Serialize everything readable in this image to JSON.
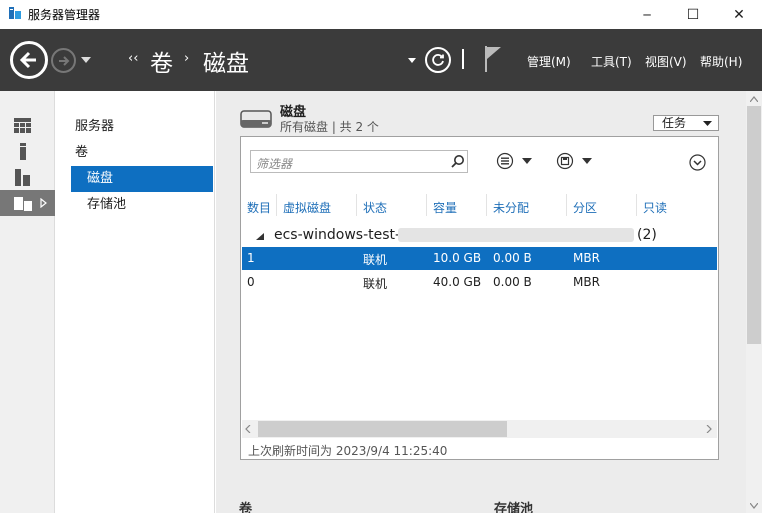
{
  "window": {
    "title": "服务器管理器",
    "controls": {
      "minimize": "─",
      "maximize": "☐",
      "close": "✕"
    }
  },
  "navbar": {
    "breadcrumb": {
      "sep1": "‹‹",
      "level1": "卷",
      "sep2": "›",
      "level2": "磁盘"
    },
    "menu": [
      "管理(M)",
      "工具(T)",
      "视图(V)",
      "帮助(H)"
    ]
  },
  "tree": {
    "items": [
      {
        "label": "服务器"
      },
      {
        "label": "卷"
      },
      {
        "label": "磁盘"
      },
      {
        "label": "存储池"
      }
    ]
  },
  "tile": {
    "title": "磁盘",
    "subtitle": "所有磁盘 | 共 2 个",
    "task_label": "任务"
  },
  "filter": {
    "placeholder": "筛选器"
  },
  "table": {
    "columns": [
      "数目",
      "虚拟磁盘",
      "状态",
      "容量",
      "未分配",
      "分区",
      "只读"
    ],
    "group": {
      "name": "ecs-windows-test-",
      "count": "(2)"
    },
    "rows": [
      {
        "number": "1",
        "virtual_disk": "",
        "status": "联机",
        "capacity": "10.0 GB",
        "unallocated": "0.00 B",
        "partition": "MBR",
        "readonly": ""
      },
      {
        "number": "0",
        "virtual_disk": "",
        "status": "联机",
        "capacity": "40.0 GB",
        "unallocated": "0.00 B",
        "partition": "MBR",
        "readonly": ""
      }
    ]
  },
  "refresh_text": "上次刷新时间为 2023/9/4 11:25:40",
  "bottom_sections": {
    "volumes": "卷",
    "storage_pools": "存储池"
  },
  "colors": {
    "accent": "#0e6fc1",
    "navbar": "#3b3b3b",
    "header_link": "#1f6fb8"
  }
}
